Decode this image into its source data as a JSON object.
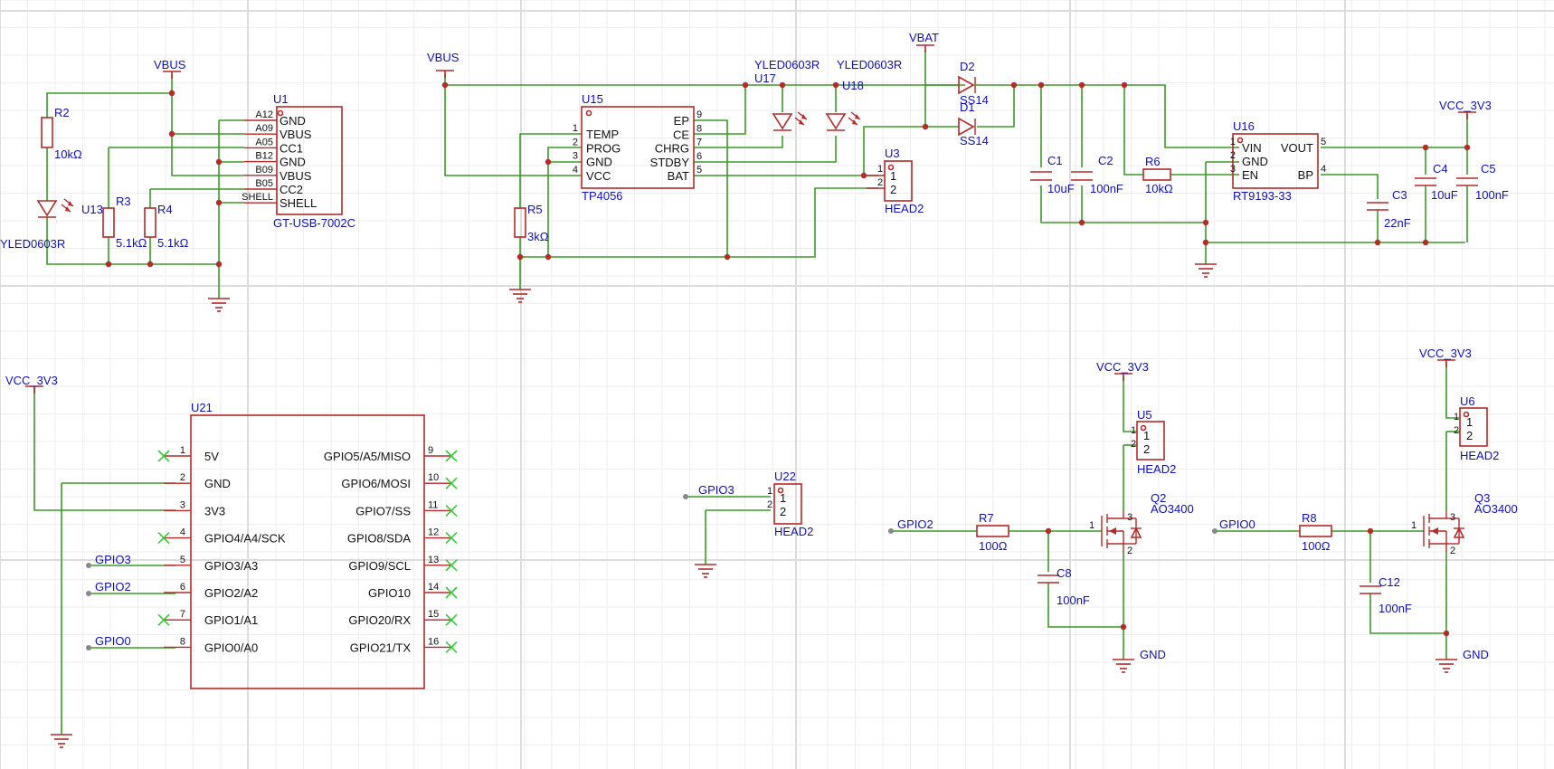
{
  "colors": {
    "wire": "#3c9a27",
    "symbol": "#b52a2a",
    "label": "#1010bb",
    "noconnect": "#33cc33"
  },
  "nets": {
    "vbus1": "VBUS",
    "vbus2": "VBUS",
    "vbat": "VBAT",
    "vcc_top": "VCC_3V3",
    "vcc_left": "VCC_3V3",
    "vcc_u5": "VCC_3V3",
    "vcc_u6": "VCC_3V3",
    "gpio3_u21": "GPIO3",
    "gpio2_u21": "GPIO2",
    "gpio0_u21": "GPIO0",
    "gpio3_u22": "GPIO3",
    "gpio2_r7": "GPIO2",
    "gpio0_r8": "GPIO0",
    "gnd_q2": "GND",
    "gnd_q3": "GND"
  },
  "components": {
    "R2": {
      "ref": "R2",
      "value": "10kΩ"
    },
    "R3": {
      "ref": "R3",
      "value": "5.1kΩ"
    },
    "R4": {
      "ref": "R4",
      "value": "5.1kΩ"
    },
    "R5": {
      "ref": "R5",
      "value": "3kΩ"
    },
    "R6": {
      "ref": "R6",
      "value": "10kΩ"
    },
    "R7": {
      "ref": "R7",
      "value": "100Ω"
    },
    "R8": {
      "ref": "R8",
      "value": "100Ω"
    },
    "C1": {
      "ref": "C1",
      "value": "10uF"
    },
    "C2": {
      "ref": "C2",
      "value": "100nF"
    },
    "C3": {
      "ref": "C3",
      "value": "22nF"
    },
    "C4": {
      "ref": "C4",
      "value": "10uF"
    },
    "C5": {
      "ref": "C5",
      "value": "100nF"
    },
    "C8": {
      "ref": "C8",
      "value": "100nF"
    },
    "C12": {
      "ref": "C12",
      "value": "100nF"
    },
    "D1": {
      "ref": "D1",
      "value": "SS14"
    },
    "D2": {
      "ref": "D2",
      "value": "SS14"
    },
    "U13": {
      "ref": "U13",
      "value": "YLED0603R"
    },
    "U17": {
      "ref": "U17",
      "value": "YLED0603R"
    },
    "U18": {
      "ref": "U18",
      "value": "YLED0603R"
    },
    "U1": {
      "ref": "U1",
      "value": "GT-USB-7002C",
      "pins": [
        {
          "num": "A12",
          "name": "GND"
        },
        {
          "num": "A09",
          "name": "VBUS"
        },
        {
          "num": "A05",
          "name": "CC1"
        },
        {
          "num": "B12",
          "name": "GND"
        },
        {
          "num": "B09",
          "name": "VBUS"
        },
        {
          "num": "B05",
          "name": "CC2"
        },
        {
          "num": "SHELL",
          "name": "SHELL"
        }
      ]
    },
    "U15": {
      "ref": "U15",
      "value": "TP4056",
      "left_pins": [
        {
          "num": "1",
          "name": "TEMP"
        },
        {
          "num": "2",
          "name": "PROG"
        },
        {
          "num": "3",
          "name": "GND"
        },
        {
          "num": "4",
          "name": "VCC"
        }
      ],
      "right_pins": [
        {
          "num": "9",
          "name": "EP"
        },
        {
          "num": "8",
          "name": "CE"
        },
        {
          "num": "7",
          "name": "CHRG"
        },
        {
          "num": "6",
          "name": "STDBY"
        },
        {
          "num": "5",
          "name": "BAT"
        }
      ]
    },
    "U16": {
      "ref": "U16",
      "value": "RT9193-33",
      "left_pins": [
        {
          "num": "1",
          "name": "VIN"
        },
        {
          "num": "2",
          "name": "GND"
        },
        {
          "num": "3",
          "name": "EN"
        }
      ],
      "right_pins": [
        {
          "num": "5",
          "name": "VOUT"
        },
        {
          "num": "4",
          "name": "BP"
        }
      ]
    },
    "U3": {
      "ref": "U3",
      "value": "HEAD2"
    },
    "U5": {
      "ref": "U5",
      "value": "HEAD2"
    },
    "U6": {
      "ref": "U6",
      "value": "HEAD2"
    },
    "U22": {
      "ref": "U22",
      "value": "HEAD2"
    },
    "Q2": {
      "ref": "Q2",
      "value": "AO3400"
    },
    "Q3": {
      "ref": "Q3",
      "value": "AO3400"
    },
    "U21": {
      "ref": "U21",
      "left_pins": [
        {
          "num": "1",
          "name": "5V"
        },
        {
          "num": "2",
          "name": "GND"
        },
        {
          "num": "3",
          "name": "3V3"
        },
        {
          "num": "4",
          "name": "GPIO4/A4/SCK"
        },
        {
          "num": "5",
          "name": "GPIO3/A3"
        },
        {
          "num": "6",
          "name": "GPIO2/A2"
        },
        {
          "num": "7",
          "name": "GPIO1/A1"
        },
        {
          "num": "8",
          "name": "GPIO0/A0"
        }
      ],
      "right_pins": [
        {
          "num": "9",
          "name": "GPIO5/A5/MISO"
        },
        {
          "num": "10",
          "name": "GPIO6/MOSI"
        },
        {
          "num": "11",
          "name": "GPIO7/SS"
        },
        {
          "num": "12",
          "name": "GPIO8/SDA"
        },
        {
          "num": "13",
          "name": "GPIO9/SCL"
        },
        {
          "num": "14",
          "name": "GPIO10"
        },
        {
          "num": "15",
          "name": "GPIO20/RX"
        },
        {
          "num": "16",
          "name": "GPIO21/TX"
        }
      ]
    }
  },
  "header_pins": {
    "p1": "1",
    "p2": "2"
  },
  "mosfet_pins": {
    "g": "1",
    "d": "3",
    "s": "2"
  }
}
